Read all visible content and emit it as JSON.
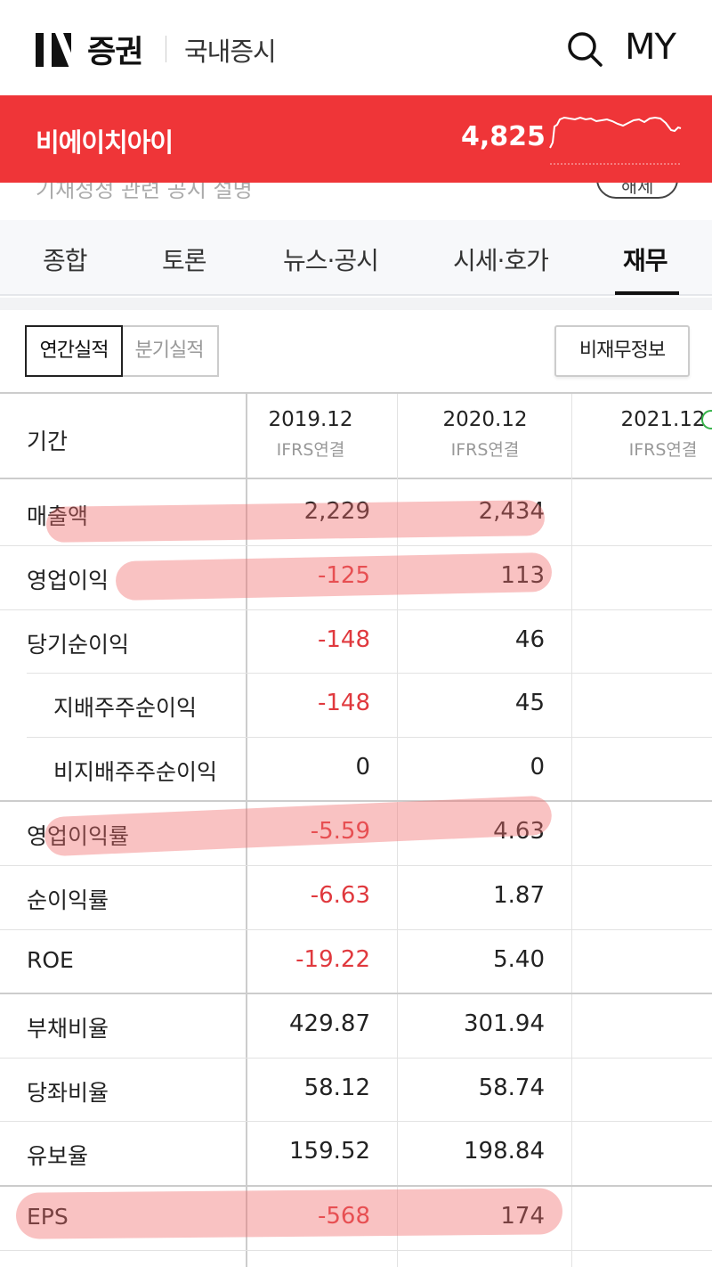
{
  "header": {
    "brand": "증권",
    "section": "국내증시",
    "my_label": "MY",
    "search_icon": "search-icon"
  },
  "ticker": {
    "name": "비에이치아이",
    "price": "4,825",
    "bg_color": "#ef3538"
  },
  "strip": {
    "text": "기재정정 관련 공시 설명",
    "button": "해제"
  },
  "tabs": [
    {
      "label": "종합"
    },
    {
      "label": "토론"
    },
    {
      "label": "뉴스·공시"
    },
    {
      "label": "시세·호가"
    },
    {
      "label": "재무",
      "active": true
    }
  ],
  "toggles": {
    "annual": "연간실적",
    "quarterly": "분기실적",
    "non_financial": "비재무정보"
  },
  "table": {
    "period_label": "기간",
    "columns": [
      {
        "year": "2019.12",
        "basis": "IFRS연결"
      },
      {
        "year": "2020.12",
        "basis": "IFRS연결"
      },
      {
        "year": "2021.12",
        "basis": "IFRS연결"
      }
    ],
    "rows": [
      {
        "label": "매출액",
        "v2019": "2,229",
        "v2020": "2,434",
        "v2021": ""
      },
      {
        "label": "영업이익",
        "v2019": "-125",
        "v2020": "113",
        "v2021": ""
      },
      {
        "label": "당기순이익",
        "v2019": "-148",
        "v2020": "46",
        "v2021": ""
      },
      {
        "label": "지배주주순이익",
        "v2019": "-148",
        "v2020": "45",
        "v2021": ""
      },
      {
        "label": "비지배주주순이익",
        "v2019": "0",
        "v2020": "0",
        "v2021": ""
      },
      {
        "label": "영업이익률",
        "v2019": "-5.59",
        "v2020": "4.63",
        "v2021": ""
      },
      {
        "label": "순이익률",
        "v2019": "-6.63",
        "v2020": "1.87",
        "v2021": ""
      },
      {
        "label": "ROE",
        "v2019": "-19.22",
        "v2020": "5.40",
        "v2021": ""
      },
      {
        "label": "부채비율",
        "v2019": "429.87",
        "v2020": "301.94",
        "v2021": ""
      },
      {
        "label": "당좌비율",
        "v2019": "58.12",
        "v2020": "58.74",
        "v2021": ""
      },
      {
        "label": "유보율",
        "v2019": "159.52",
        "v2020": "198.84",
        "v2021": ""
      },
      {
        "label": "EPS",
        "v2019": "-568",
        "v2020": "174",
        "v2021": ""
      }
    ]
  },
  "colors": {
    "negative": "#e0393e",
    "highlight": "rgba(240,110,110,0.42)"
  }
}
